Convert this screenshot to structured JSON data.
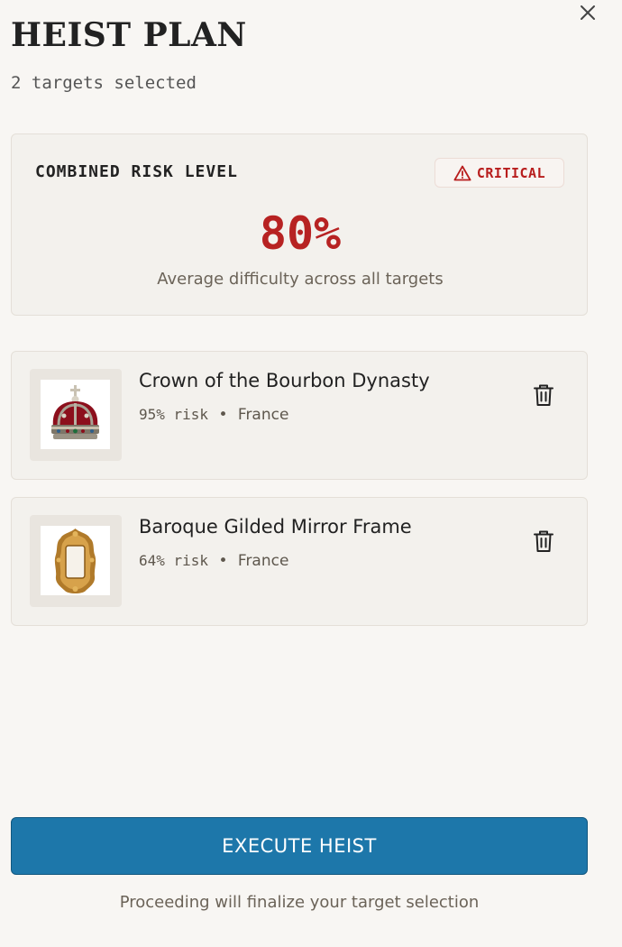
{
  "header": {
    "title": "HEIST PLAN",
    "subtitle": "2 targets selected",
    "close_icon": "close-icon"
  },
  "risk": {
    "label": "COMBINED RISK LEVEL",
    "badge_icon": "warning-icon",
    "badge": "CRITICAL",
    "value": "80%",
    "description": "Average difficulty across all targets",
    "accent_color": "#b72222"
  },
  "targets": [
    {
      "name": "Crown of the Bourbon Dynasty",
      "risk": "95% risk",
      "separator": "•",
      "country": "France",
      "image_icon": "crown-image",
      "action_icon": "trash-icon"
    },
    {
      "name": "Baroque Gilded Mirror Frame",
      "risk": "64% risk",
      "separator": "•",
      "country": "France",
      "image_icon": "mirror-frame-image",
      "action_icon": "trash-icon"
    }
  ],
  "actions": {
    "execute_label": "EXECUTE HEIST",
    "execute_color": "#1d77aa",
    "note": "Proceeding will finalize your target selection"
  }
}
